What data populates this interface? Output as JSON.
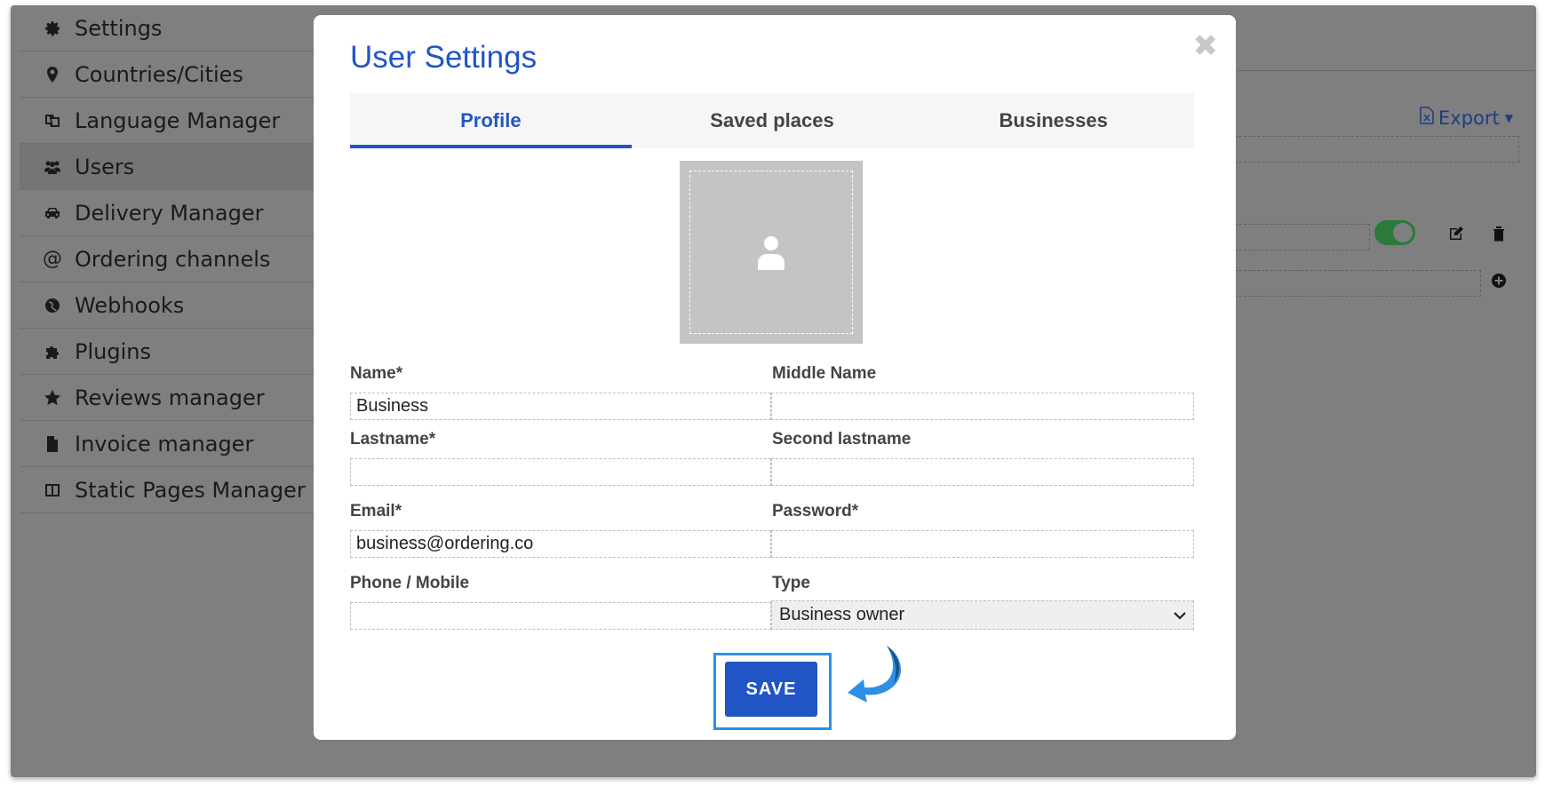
{
  "sidebar": {
    "items": [
      {
        "label": "Settings",
        "icon": "gear-icon"
      },
      {
        "label": "Countries/Cities",
        "icon": "map-pin-icon"
      },
      {
        "label": "Language Manager",
        "icon": "language-icon"
      },
      {
        "label": "Users",
        "icon": "users-icon"
      },
      {
        "label": "Delivery Manager",
        "icon": "car-icon"
      },
      {
        "label": "Ordering channels",
        "icon": "at-icon"
      },
      {
        "label": "Webhooks",
        "icon": "globe-icon"
      },
      {
        "label": "Plugins",
        "icon": "puzzle-icon"
      },
      {
        "label": "Reviews manager",
        "icon": "star-icon"
      },
      {
        "label": "Invoice manager",
        "icon": "file-icon"
      },
      {
        "label": "Static Pages Manager",
        "icon": "columns-icon"
      }
    ],
    "active": "Users"
  },
  "background": {
    "export_label": "Export",
    "toggle_on": true
  },
  "modal": {
    "title": "User Settings",
    "close_symbol": "✖",
    "tabs": [
      {
        "label": "Profile",
        "active": true
      },
      {
        "label": "Saved places",
        "active": false
      },
      {
        "label": "Businesses",
        "active": false
      }
    ],
    "fields": {
      "name": {
        "label": "Name*",
        "value": "Business"
      },
      "middle_name": {
        "label": "Middle Name",
        "value": ""
      },
      "lastname": {
        "label": "Lastname*",
        "value": ""
      },
      "second_lastname": {
        "label": "Second lastname",
        "value": ""
      },
      "email": {
        "label": "Email*",
        "value": "business@ordering.co"
      },
      "password": {
        "label": "Password*",
        "value": ""
      },
      "phone": {
        "label": "Phone / Mobile",
        "value": ""
      },
      "type": {
        "label": "Type",
        "value": "Business owner"
      }
    },
    "save_label": "SAVE"
  },
  "colors": {
    "accent": "#2255c4",
    "highlight": "#2d8fe8",
    "overlay": "#7f7f7f"
  }
}
